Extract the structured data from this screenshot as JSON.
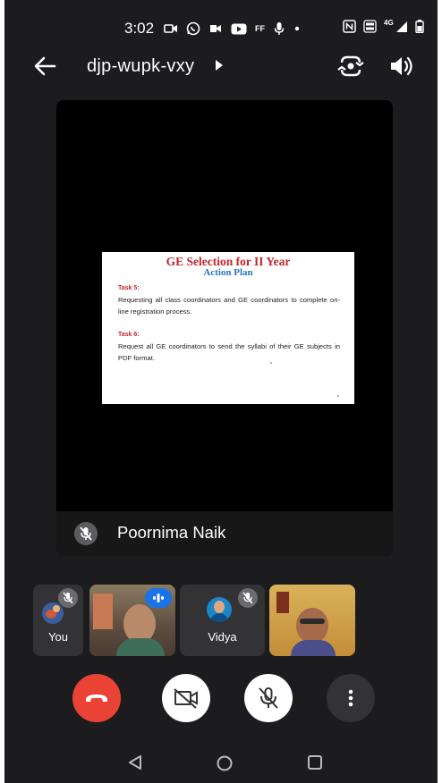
{
  "status_bar": {
    "time": "3:02",
    "network": "4G",
    "icons": [
      "video-call-icon",
      "whatsapp-icon",
      "meet-icon",
      "youtube-icon",
      "ff-icon",
      "mic-icon",
      "dot-icon",
      "nfc-icon",
      "volte-icon",
      "signal-icon",
      "battery-icon"
    ],
    "ff_label": "FF"
  },
  "top_bar": {
    "meeting_code": "djp-wupk-vxy",
    "icons": [
      "back-arrow-icon",
      "caret-right-icon",
      "switch-camera-icon",
      "speaker-icon"
    ]
  },
  "main_tile": {
    "participant_name": "Poornima Naik",
    "mic_state": "muted",
    "slide": {
      "title": "GE Selection for II Year",
      "subtitle": "Action Plan",
      "tasks": [
        {
          "label": "Task 5:",
          "text": "Requesting all class coordinators and GE coordinators to complete on-line registration process."
        },
        {
          "label": "Task 6:",
          "text": "Request all GE coordinators to send the syllabi of their GE subjects in PDF format."
        }
      ]
    }
  },
  "filmstrip": {
    "tiles": [
      {
        "label": "You",
        "mic_state": "muted"
      },
      {
        "label": "",
        "mic_state": "speaking"
      },
      {
        "label": "Vidya",
        "mic_state": "muted"
      },
      {
        "label": "",
        "mic_state": "unknown"
      }
    ]
  },
  "controls": {
    "buttons": [
      "hang-up",
      "camera-off",
      "mic-off",
      "more-options"
    ],
    "colors": {
      "hangup": "#ea4335",
      "active": "#ffffff",
      "more": "#333335",
      "speaking_badge": "#1a73e8"
    }
  },
  "nav_bar": {
    "buttons": [
      "back",
      "home",
      "recents"
    ]
  }
}
